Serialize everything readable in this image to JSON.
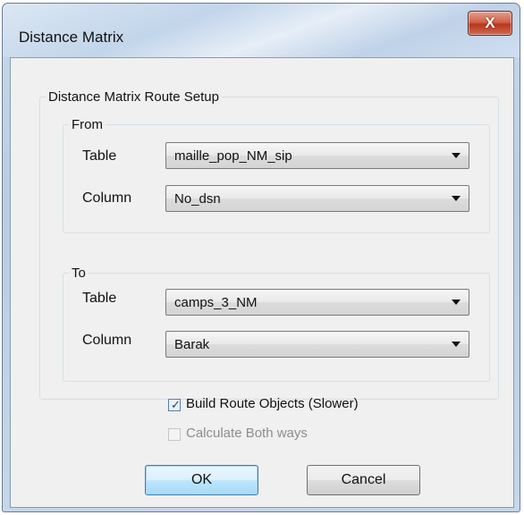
{
  "window": {
    "title": "Distance Matrix",
    "close_label": "X"
  },
  "setup": {
    "group_label": "Distance Matrix Route Setup",
    "from": {
      "label": "From",
      "table_label": "Table",
      "table_value": "maille_pop_NM_sip",
      "column_label": "Column",
      "column_value": "No_dsn"
    },
    "to": {
      "label": "To",
      "table_label": "Table",
      "table_value": "camps_3_NM",
      "column_label": "Column",
      "column_value": "Barak"
    }
  },
  "options": {
    "build_route": {
      "label": "Build Route Objects (Slower)",
      "checked": true
    },
    "calc_both": {
      "label": "Calculate Both ways",
      "checked": false,
      "enabled": false
    }
  },
  "buttons": {
    "ok": "OK",
    "cancel": "Cancel"
  }
}
